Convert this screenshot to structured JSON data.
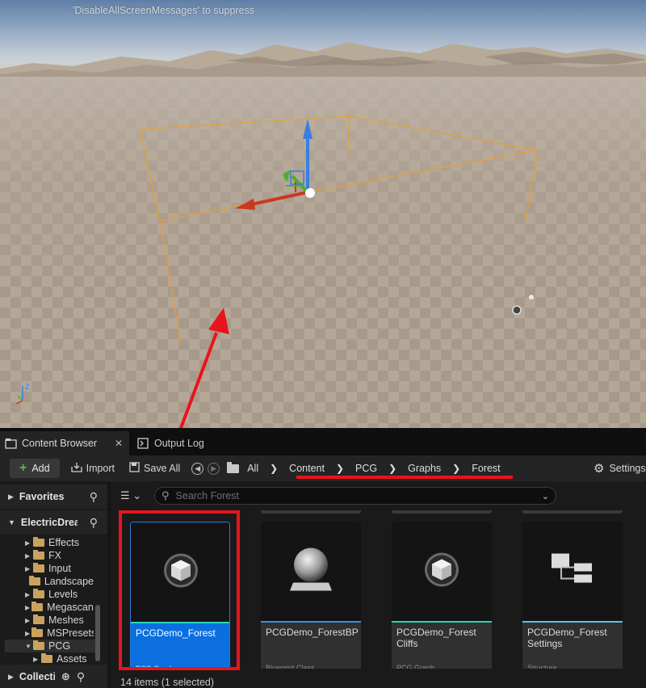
{
  "viewport": {
    "screen_message": "'DisableAllScreenMessages' to suppress"
  },
  "tabs": [
    {
      "label": "Content Browser",
      "close": "✕"
    },
    {
      "label": "Output Log"
    }
  ],
  "toolbar": {
    "add_label": "Add",
    "import_label": "Import",
    "save_all_label": "Save All",
    "settings_label": "Settings"
  },
  "breadcrumb": [
    "All",
    "Content",
    "PCG",
    "Graphs",
    "Forest"
  ],
  "left_panel": {
    "favorites": "Favorites",
    "project": "ElectricDreams",
    "collections": "Collections",
    "tree": [
      {
        "label": "Effects",
        "expandable": true
      },
      {
        "label": "FX",
        "expandable": true
      },
      {
        "label": "Input",
        "expandable": true
      },
      {
        "label": "Landscape",
        "expandable": false
      },
      {
        "label": "Levels",
        "expandable": true
      },
      {
        "label": "Megascans",
        "expandable": true
      },
      {
        "label": "Meshes",
        "expandable": true
      },
      {
        "label": "MSPresets",
        "expandable": true
      },
      {
        "label": "PCG",
        "expandable": true,
        "expanded": true,
        "selected": true
      },
      {
        "label": "Assets",
        "expandable": true,
        "child": true
      }
    ]
  },
  "search": {
    "placeholder": "Search Forest"
  },
  "assets": [
    {
      "name": "PCGDemo_Forest",
      "type": "PCG Graph",
      "icon": "pcg-graph-icon",
      "color": "#2bd6b4",
      "selected": true
    },
    {
      "name": "PCGDemo_ForestBP",
      "type": "Blueprint Class",
      "icon": "blueprint-sphere-icon",
      "color": "#3d8ee6",
      "selected": false
    },
    {
      "name": "PCGDemo_Forest Cliffs",
      "type": "PCG Graph",
      "icon": "pcg-graph-icon",
      "color": "#2bd6b4",
      "selected": false
    },
    {
      "name": "PCGDemo_Forest Settings",
      "type": "Structure",
      "icon": "structure-icon",
      "color": "#5ec3e6",
      "selected": false
    }
  ],
  "status": "14 items (1 selected)",
  "colors": {
    "annotation_red": "#e8141c",
    "selection_blue": "#0b6fe0",
    "gizmo_x": "#c83a1e",
    "gizmo_y": "#4caf2a",
    "gizmo_z": "#3a7fe0",
    "bounds": "#e8a030"
  }
}
